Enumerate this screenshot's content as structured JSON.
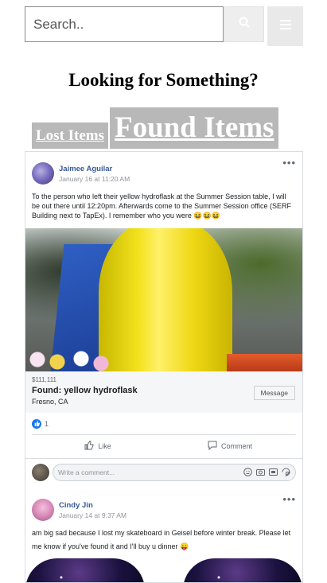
{
  "search": {
    "placeholder": "Search.."
  },
  "page": {
    "headline": "Looking for Something?"
  },
  "tabs": {
    "lost_label": "Lost Items",
    "found_label": "Found Items"
  },
  "posts": [
    {
      "author": "Jaimee Aguilar",
      "time": "January 16 at 11:20 AM",
      "text": "To the person who left their yellow hydroflask at the Summer Session table, I will be out there until 12:20pm. Afterwards come to the Summer Session office (SERF Building next to TapEx). I remember who you were 😆😆😆",
      "listing": {
        "price": "$111,111",
        "title": "Found: yellow hydroflask",
        "location": "Fresno, CA",
        "message_label": "Message"
      },
      "like_count": "1",
      "like_label": "Like",
      "comment_label": "Comment",
      "comment_placeholder": "Write a comment..."
    },
    {
      "author": "Cindy Jin",
      "time": "January 14 at 9:37 AM",
      "text": "am big sad because I lost my skateboard in Geisel before winter break. Please let me know if you've found it and I'll buy u dinner 😛"
    }
  ],
  "colors": {
    "author_link": "#385898",
    "like_blue": "#1877f2",
    "tab_bg": "#b8b8b8"
  }
}
